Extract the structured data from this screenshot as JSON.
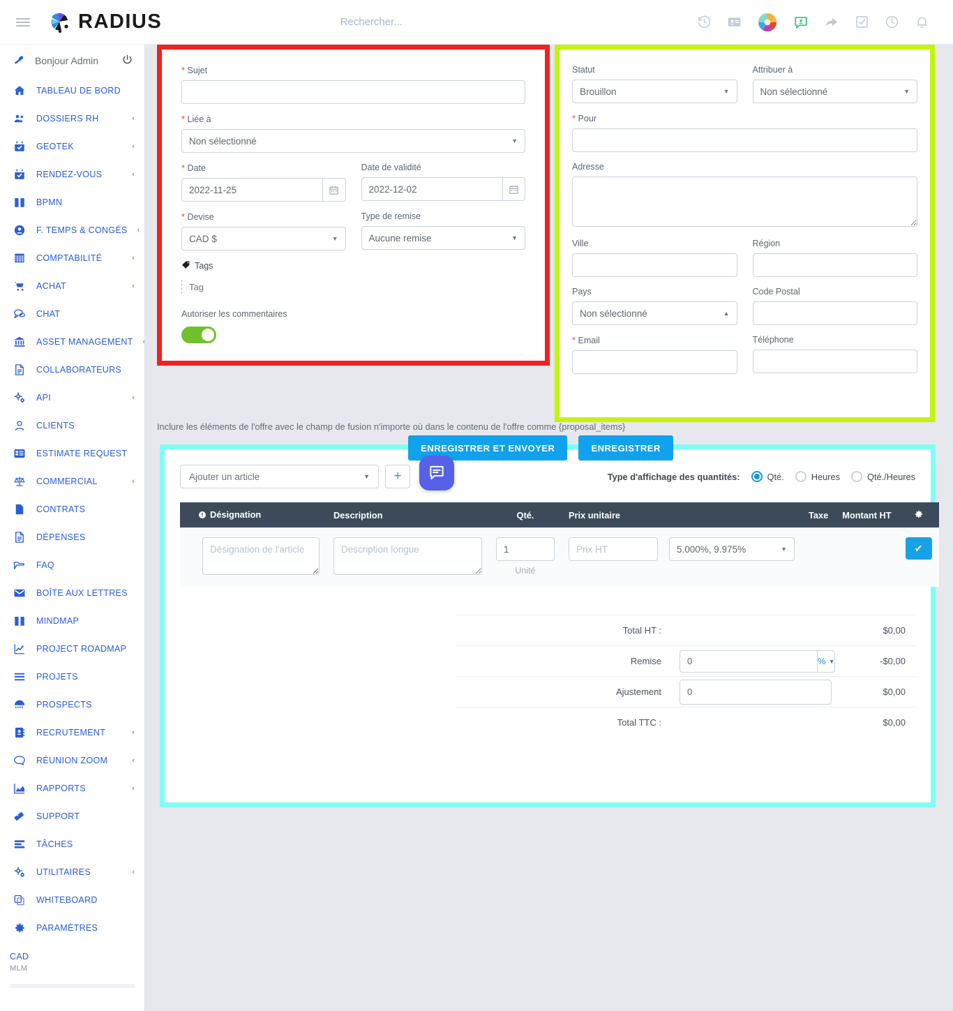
{
  "app": {
    "brand": "RADIUS"
  },
  "topbar": {
    "search_placeholder": "Rechercher...",
    "icons": [
      {
        "name": "history-icon"
      },
      {
        "name": "contact-card-icon"
      },
      {
        "name": "globe-icon"
      },
      {
        "name": "chat-user-icon"
      },
      {
        "name": "share-arrow-icon"
      },
      {
        "name": "checkbox-icon"
      },
      {
        "name": "clock-icon"
      },
      {
        "name": "bell-icon"
      }
    ]
  },
  "sidebar": {
    "greeting": "Bonjour Admin",
    "power_icon": "power-icon",
    "items": [
      {
        "label": "TABLEAU DE BORD",
        "icon": "home-icon",
        "chevron": false
      },
      {
        "label": "DOSSIERS RH",
        "icon": "users-icon",
        "chevron": true
      },
      {
        "label": "GEOTEK",
        "icon": "calendar-check-icon",
        "chevron": true
      },
      {
        "label": "RENDEZ-VOUS",
        "icon": "calendar-check-icon",
        "chevron": true
      },
      {
        "label": "BPMN",
        "icon": "book-icon",
        "chevron": false
      },
      {
        "label": "F. TEMPS & CONGÉS",
        "icon": "user-circle-icon",
        "chevron": true
      },
      {
        "label": "COMPTABILITÉ",
        "icon": "grid-icon",
        "chevron": true
      },
      {
        "label": "ACHAT",
        "icon": "cart-icon",
        "chevron": true
      },
      {
        "label": "CHAT",
        "icon": "chat-bubbles-icon",
        "chevron": false
      },
      {
        "label": "ASSET MANAGEMENT",
        "icon": "bank-icon",
        "chevron": true
      },
      {
        "label": "COLLABORATEURS",
        "icon": "document-icon",
        "chevron": false
      },
      {
        "label": "API",
        "icon": "gears-icon",
        "chevron": true
      },
      {
        "label": "CLIENTS",
        "icon": "user-icon",
        "chevron": false
      },
      {
        "label": "ESTIMATE REQUEST",
        "icon": "list-card-icon",
        "chevron": false
      },
      {
        "label": "COMMERCIAL",
        "icon": "scales-icon",
        "chevron": true
      },
      {
        "label": "CONTRATS",
        "icon": "file-icon",
        "chevron": false
      },
      {
        "label": "DÉPENSES",
        "icon": "document-icon",
        "chevron": false
      },
      {
        "label": "FAQ",
        "icon": "folder-open-icon",
        "chevron": false
      },
      {
        "label": "BOÎTE AUX LETTRES",
        "icon": "envelope-icon",
        "chevron": false
      },
      {
        "label": "MINDMAP",
        "icon": "book-icon",
        "chevron": false
      },
      {
        "label": "PROJECT ROADMAP",
        "icon": "chart-line-icon",
        "chevron": false
      },
      {
        "label": "PROJETS",
        "icon": "bars-icon",
        "chevron": false
      },
      {
        "label": "PROSPECTS",
        "icon": "network-icon",
        "chevron": false
      },
      {
        "label": "RECRUTEMENT",
        "icon": "address-book-icon",
        "chevron": true
      },
      {
        "label": "RÉUNION ZOOM",
        "icon": "speech-bubble-icon",
        "chevron": true
      },
      {
        "label": "RAPPORTS",
        "icon": "chart-area-icon",
        "chevron": true
      },
      {
        "label": "SUPPORT",
        "icon": "ticket-icon",
        "chevron": false
      },
      {
        "label": "TÂCHES",
        "icon": "tasks-icon",
        "chevron": false
      },
      {
        "label": "UTILITAIRES",
        "icon": "gears-icon",
        "chevron": true
      },
      {
        "label": "WHITEBOARD",
        "icon": "copy-icon",
        "chevron": false
      },
      {
        "label": "PARAMÈTRES",
        "icon": "gear-icon",
        "chevron": false
      }
    ],
    "footer_line1": "CAD",
    "footer_line2": "MLM"
  },
  "left_form": {
    "sujet": {
      "label": "Sujet",
      "required": true,
      "value": ""
    },
    "liee_a": {
      "label": "Liée à",
      "required": true,
      "value": "Non sélectionné"
    },
    "date": {
      "label": "Date",
      "required": true,
      "value": "2022-11-25"
    },
    "date_validite": {
      "label": "Date de validité",
      "required": false,
      "value": "2022-12-02"
    },
    "devise": {
      "label": "Devise",
      "required": true,
      "value": "CAD $"
    },
    "type_remise": {
      "label": "Type de remise",
      "required": false,
      "value": "Aucune remise"
    },
    "tags": {
      "label": "Tags",
      "placeholder": "Tag",
      "value": ""
    },
    "commentaires": {
      "label": "Autoriser les commentaires",
      "on": true
    }
  },
  "right_form": {
    "statut": {
      "label": "Statut",
      "value": "Brouillon"
    },
    "attribuer_a": {
      "label": "Attribuer à",
      "value": "Non sélectionné"
    },
    "pour": {
      "label": "Pour",
      "required": true,
      "value": ""
    },
    "adresse": {
      "label": "Adresse",
      "value": ""
    },
    "ville": {
      "label": "Ville",
      "value": ""
    },
    "region": {
      "label": "Région",
      "value": ""
    },
    "pays": {
      "label": "Pays",
      "value": "Non sélectionné"
    },
    "code_postal": {
      "label": "Code Postal",
      "value": ""
    },
    "email": {
      "label": "Email",
      "required": true,
      "value": ""
    },
    "telephone": {
      "label": "Téléphone",
      "value": ""
    }
  },
  "merge_note": "Inclure les éléments de l'offre avec le champ de fusion n'importe où dans le contenu de l'offre comme {proposal_items}",
  "actions": {
    "save_and_send": "ENREGISTRER ET ENVOYER",
    "save": "ENREGISTRER"
  },
  "chat_fab": {
    "icon": "comment-icon"
  },
  "items": {
    "add_article": "Ajouter un article",
    "add_button_icon": "plus-icon",
    "qty_type_label": "Type d'affichage des quantités:",
    "qty_options": [
      {
        "label": "Qté.",
        "selected": true
      },
      {
        "label": "Heures",
        "selected": false
      },
      {
        "label": "Qté./Heures",
        "selected": false
      }
    ],
    "columns": [
      "Désignation",
      "Description",
      "Qté.",
      "Prix unitaire",
      "Taxe",
      "Montant HT",
      ""
    ],
    "header_gear_icon": "gear-icon",
    "header_info_icon": "info-icon",
    "row": {
      "designation_placeholder": "Désignation de l'article",
      "description_placeholder": "Description longue",
      "qty_value": "1",
      "unit_label": "Unité",
      "price_placeholder": "Prix HT",
      "tax_value": "5.000%, 9.975%",
      "confirm_icon": "check-icon"
    }
  },
  "totals": {
    "total_ht_label": "Total HT :",
    "total_ht_value": "$0,00",
    "remise_label": "Remise",
    "remise_value": "0",
    "remise_unit": "%",
    "remise_amount": "-$0,00",
    "ajustement_label": "Ajustement",
    "ajustement_value": "0",
    "ajustement_amount": "$0,00",
    "total_ttc_label": "Total TTC :",
    "total_ttc_value": "$0,00"
  },
  "colors": {
    "highlight_red": "#ee2222",
    "highlight_yellow": "#c3f50a",
    "highlight_cyan": "#7ffff5",
    "accent_blue": "#10a2ec",
    "toggle_green": "#72c02c",
    "table_header": "#3c4a5c",
    "nav_blue": "#2a5bd7"
  }
}
